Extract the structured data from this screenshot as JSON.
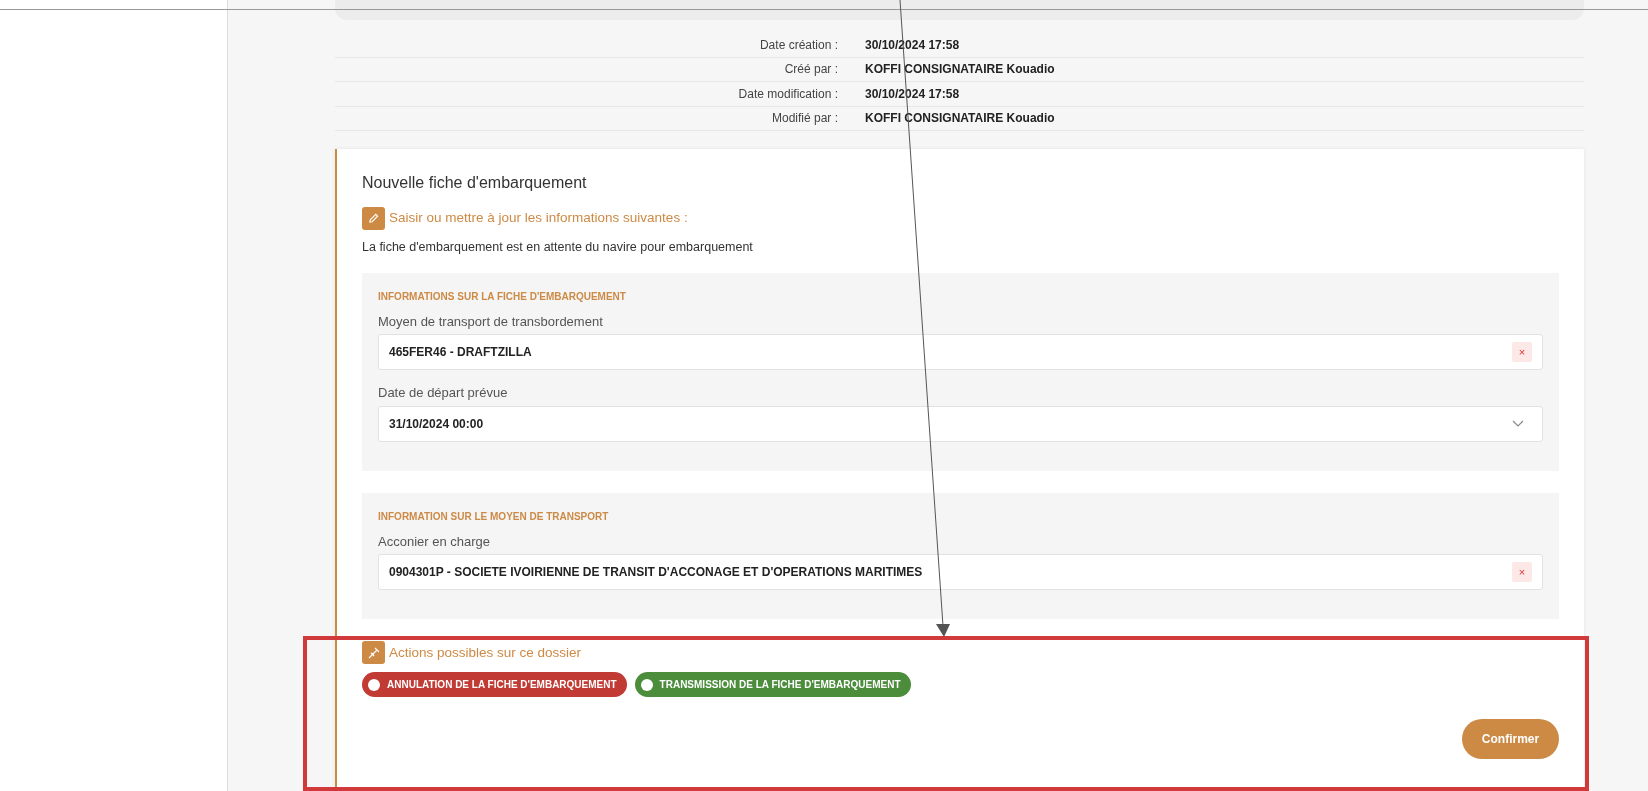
{
  "update_dates": [
    {
      "label": "Date création :",
      "value": "30/10/2024 17:58"
    },
    {
      "label": "Créé par :",
      "value": "KOFFI CONSIGNATAIRE Kouadio"
    },
    {
      "label": "Date modification :",
      "value": "30/10/2024 17:58"
    },
    {
      "label": "Modifié par :",
      "value": "KOFFI CONSIGNATAIRE Kouadio"
    }
  ],
  "form": {
    "title": "Nouvelle fiche d'embarquement",
    "instruction": "Saisir ou mettre à jour les informations suivantes :",
    "status_text": "La fiche d'embarquement est en attente du navire pour embarquement",
    "sections": [
      {
        "heading": "INFORMATIONS SUR LA FICHE D'EMBARQUEMENT",
        "fields": [
          {
            "kind": "clearable",
            "label": "Moyen de transport de transbordement",
            "value": "465FER46 - DRAFTZILLA",
            "clear_button": "×"
          },
          {
            "kind": "dropdown",
            "label": "Date de départ prévue",
            "value": "31/10/2024 00:00"
          }
        ]
      },
      {
        "heading": "INFORMATION SUR LE MOYEN DE TRANSPORT",
        "fields": [
          {
            "kind": "clearable",
            "label": "Acconier en charge",
            "value": "0904301P - SOCIETE IVOIRIENNE DE TRANSIT D'ACCONAGE ET D'OPERATIONS MARITIMES",
            "clear_button": "×"
          }
        ]
      }
    ],
    "actions_heading": "Actions possibles sur ce dossier",
    "actions": [
      {
        "label": "ANNULATION DE LA FICHE D'EMBARQUEMENT",
        "color": "#c13a34",
        "selected": false
      },
      {
        "label": "TRANSMISSION DE LA FICHE D'EMBARQUEMENT",
        "color": "#4b8d3b",
        "selected": false
      }
    ],
    "confirm_button": "Confirmer"
  }
}
